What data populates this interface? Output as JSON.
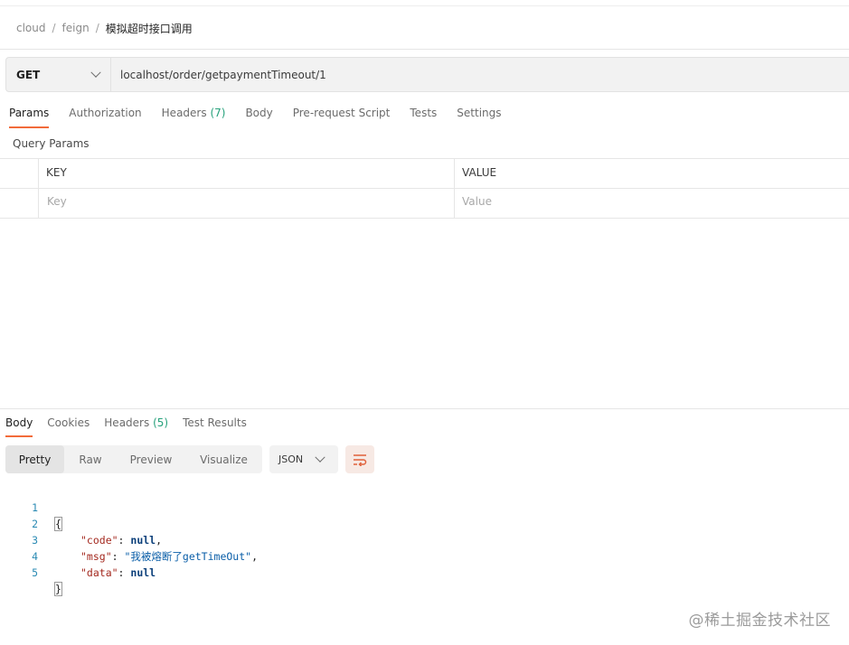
{
  "breadcrumb": {
    "items": [
      "cloud",
      "feign"
    ],
    "current": "模拟超时接口调用"
  },
  "request": {
    "method": "GET",
    "url": "localhost/order/getpaymentTimeout/1",
    "tabs": [
      {
        "label": "Params",
        "active": true
      },
      {
        "label": "Authorization"
      },
      {
        "label": "Headers",
        "count": "(7)"
      },
      {
        "label": "Body"
      },
      {
        "label": "Pre-request Script"
      },
      {
        "label": "Tests"
      },
      {
        "label": "Settings"
      }
    ],
    "query_params_title": "Query Params",
    "table": {
      "headers": [
        "KEY",
        "VALUE"
      ],
      "placeholders": [
        "Key",
        "Value"
      ]
    }
  },
  "response": {
    "tabs": [
      {
        "label": "Body",
        "active": true
      },
      {
        "label": "Cookies"
      },
      {
        "label": "Headers",
        "count": "(5)"
      },
      {
        "label": "Test Results"
      }
    ],
    "views": [
      "Pretty",
      "Raw",
      "Preview",
      "Visualize"
    ],
    "active_view": "Pretty",
    "format": "JSON",
    "line_numbers": [
      "1",
      "2",
      "3",
      "4",
      "5"
    ],
    "code": {
      "open": "{",
      "close": "}",
      "fields": [
        {
          "key": "\"code\"",
          "value": "null",
          "kind": "null"
        },
        {
          "key": "\"msg\"",
          "value": "\"我被熔断了getTimeOut\"",
          "kind": "string"
        },
        {
          "key": "\"data\"",
          "value": "null",
          "kind": "null"
        }
      ]
    }
  },
  "watermark": "@稀土掘金技术社区",
  "colors": {
    "accent": "#f26b3a",
    "count": "#26a17b",
    "line_number": "#2a8ab3"
  },
  "icons": {
    "method_dropdown": "chevron-down-icon",
    "format_dropdown": "chevron-down-icon",
    "wrap": "wrap-lines-icon"
  }
}
